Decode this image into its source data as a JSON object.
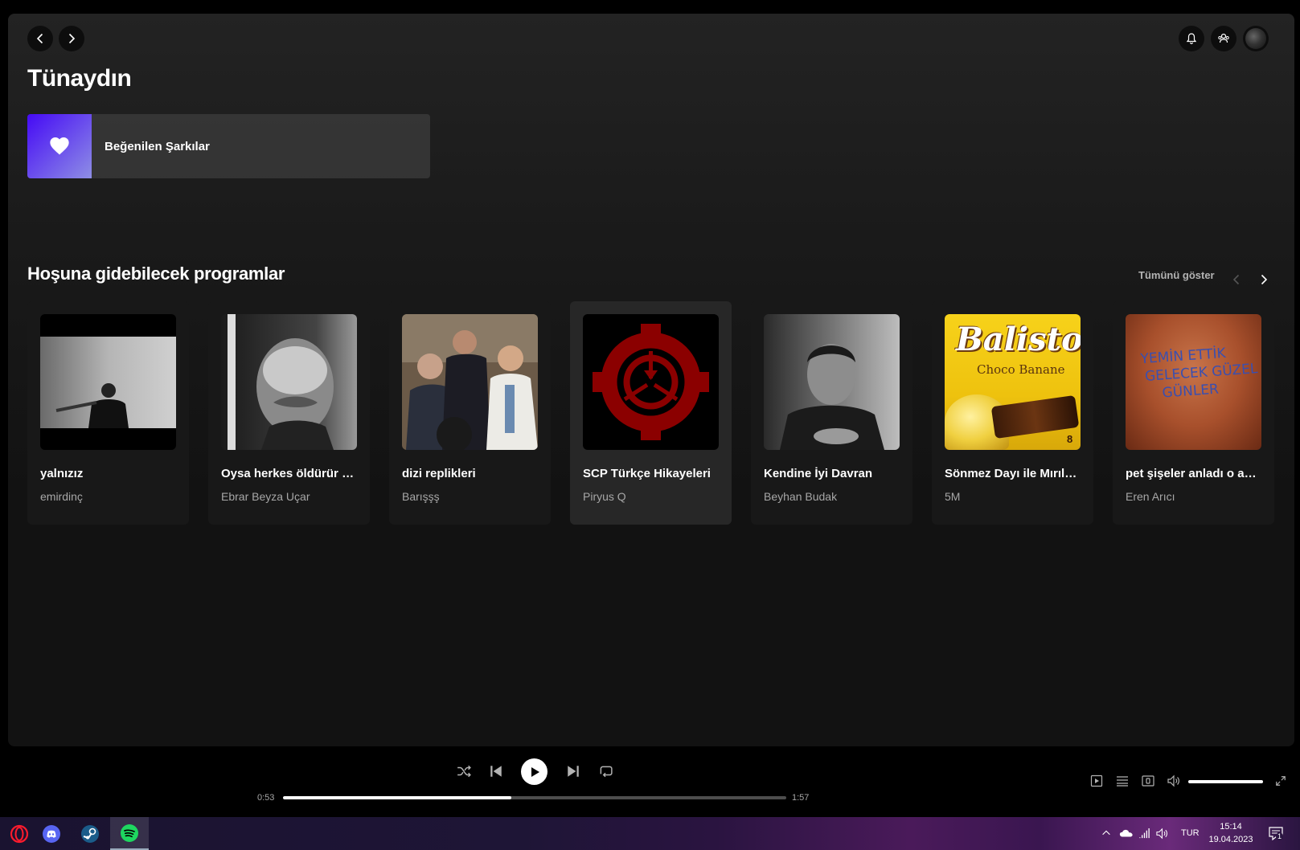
{
  "header": {
    "greeting": "Tünaydın"
  },
  "shortcut": {
    "label": "Beğenilen Şarkılar",
    "gradient_from": "#450af5",
    "gradient_to": "#8e8ee5"
  },
  "section": {
    "title": "Hoşuna gidebilecek programlar",
    "show_all": "Tümünü göster"
  },
  "cards": [
    {
      "title": "yalnızız",
      "subtitle": "emirdinç",
      "art": "bw-man-photo"
    },
    {
      "title": "Oysa herkes öldürür sevdiğini",
      "subtitle": "Ebrar Beyza Uçar",
      "art": "old-man-photo"
    },
    {
      "title": "dizi replikleri",
      "subtitle": "Barışşş",
      "art": "tv-series-photo"
    },
    {
      "title": "SCP Türkçe Hikayeleri",
      "subtitle": "Piryus Q",
      "art": "scp-logo"
    },
    {
      "title": "Kendine İyi Davran",
      "subtitle": "Beyhan Budak",
      "art": "portrait-photo"
    },
    {
      "title": "Sönmez Dayı ile Mırıltılar",
      "subtitle": "5M",
      "art": "balisto-package"
    },
    {
      "title": "pet şişeler anladı o akşam",
      "subtitle": "Eren Arıcı",
      "art": "graffiti-wall"
    }
  ],
  "balisto_art": {
    "brand": "Balisto",
    "flavor": "Choco Banane",
    "count": "8"
  },
  "graffiti_art": {
    "line1": "YEMİN ETTİK",
    "line2": "GELECEK GÜZEL",
    "line3": "GÜNLER"
  },
  "player": {
    "current_time": "0:53",
    "total_time": "1:57",
    "progress_fraction": 0.453,
    "volume_fraction": 1.0
  },
  "taskbar": {
    "lang": "TUR",
    "time": "15:14",
    "date": "19.04.2023",
    "notification_count": "1"
  },
  "colors": {
    "accent_green": "#1ed760",
    "background": "#121212"
  }
}
